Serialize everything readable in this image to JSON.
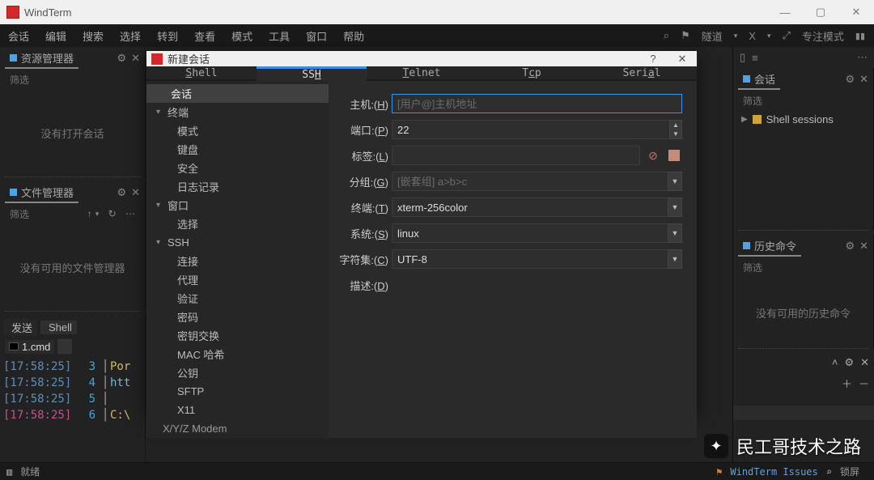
{
  "app_title": "WindTerm",
  "menu": [
    "会话",
    "编辑",
    "搜索",
    "选择",
    "转到",
    "查看",
    "模式",
    "工具",
    "窗口",
    "帮助"
  ],
  "menu_right": {
    "search": "⌕",
    "tunnel": "隧道",
    "x": "X",
    "focus": "专注模式"
  },
  "panels": {
    "resource": {
      "title": "资源管理器",
      "filter": "筛选",
      "empty": "没有打开会话"
    },
    "filemgr": {
      "title": "文件管理器",
      "filter": "筛选",
      "empty": "没有可用的文件管理器"
    },
    "send_tab1": "发送",
    "send_tab2": "Shell",
    "cmd_tab": "1.cmd",
    "sessions": {
      "title": "会话",
      "filter": "筛选",
      "entry": "Shell sessions"
    },
    "history": {
      "title": "历史命令",
      "filter": "筛选",
      "empty": "没有可用的历史命令"
    }
  },
  "cmd_lines": [
    {
      "ts": "[17:58:25]",
      "n": "3",
      "txt": "Por",
      "cls": "tok-y"
    },
    {
      "ts": "[17:58:25]",
      "n": "4",
      "txt": "htt",
      "cls": "tok-c"
    },
    {
      "ts": "[17:58:25]",
      "n": "5",
      "txt": "",
      "cls": ""
    },
    {
      "ts": "[17:58:25]",
      "n": "6",
      "txt": "C:\\",
      "cls": "tok-y",
      "pink": true
    }
  ],
  "dialog": {
    "title": "新建会话",
    "tabs": [
      "Shell",
      "SSH",
      "Telnet",
      "Tcp",
      "Serial"
    ],
    "active_tab": 1,
    "side": {
      "root": "会话",
      "terminal": {
        "label": "终端",
        "children": [
          "模式",
          "键盘",
          "安全",
          "日志记录"
        ]
      },
      "window": {
        "label": "窗口",
        "children": [
          "选择"
        ]
      },
      "ssh": {
        "label": "SSH",
        "children": [
          "连接",
          "代理",
          "验证",
          "密码",
          "密钥交换",
          "MAC 哈希",
          "公钥",
          "SFTP",
          "X11"
        ]
      },
      "modem": "X/Y/Z Modem"
    },
    "form": {
      "host": {
        "label": "主机:(",
        "key": "H",
        "after": ")",
        "placeholder": "[用户@]主机地址",
        "value": ""
      },
      "port": {
        "label": "端口:(",
        "key": "P",
        "after": ")",
        "value": "22"
      },
      "tag": {
        "label": "标签:(",
        "key": "L",
        "after": ")",
        "value": ""
      },
      "group": {
        "label": "分组:(",
        "key": "G",
        "after": ")",
        "placeholder": "[嵌套组] a>b>c",
        "value": ""
      },
      "term": {
        "label": "终端:(",
        "key": "T",
        "after": ")",
        "value": "xterm-256color"
      },
      "os": {
        "label": "系统:(",
        "key": "S",
        "after": ")",
        "value": "linux"
      },
      "charset": {
        "label": "字符集:(",
        "key": "C",
        "after": ")",
        "value": "UTF-8"
      },
      "desc": {
        "label": "描述:(",
        "key": "D",
        "after": ")",
        "value": ""
      }
    }
  },
  "statusbar": {
    "left": "就绪",
    "mid": "WindTerm Issues",
    "right": "锁屏"
  },
  "watermark": "民工哥技术之路"
}
